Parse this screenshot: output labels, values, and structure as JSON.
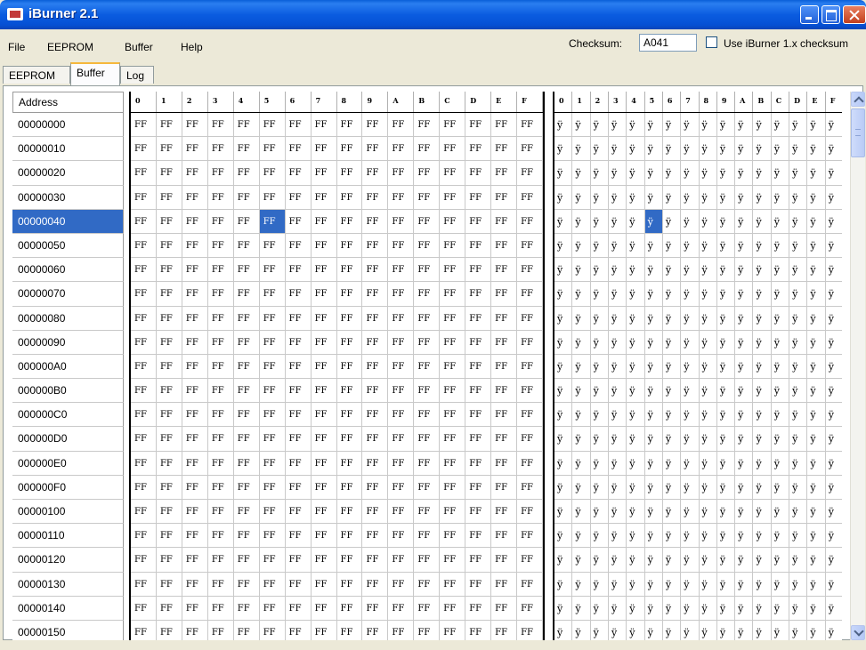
{
  "window": {
    "title": "iBurner 2.1"
  },
  "menu": {
    "items": [
      "File",
      "EEPROM",
      "Buffer",
      "Help"
    ]
  },
  "checksum": {
    "label": "Checksum:",
    "value": "A041",
    "use_legacy_label": "Use iBurner 1.x checksum",
    "use_legacy_checked": false
  },
  "tabs": [
    {
      "label": "EEPROM",
      "active": false
    },
    {
      "label": "Buffer",
      "active": true
    },
    {
      "label": "Log",
      "active": false
    }
  ],
  "grid": {
    "address_header": "Address",
    "hex_columns": [
      "0",
      "1",
      "2",
      "3",
      "4",
      "5",
      "6",
      "7",
      "8",
      "9",
      "A",
      "B",
      "C",
      "D",
      "E",
      "F"
    ],
    "ascii_columns": [
      "0",
      "1",
      "2",
      "3",
      "4",
      "5",
      "6",
      "7",
      "8",
      "9",
      "A",
      "B",
      "C",
      "D",
      "E",
      "F"
    ],
    "addresses": [
      "00000000",
      "00000010",
      "00000020",
      "00000030",
      "00000040",
      "00000050",
      "00000060",
      "00000070",
      "00000080",
      "00000090",
      "000000A0",
      "000000B0",
      "000000C0",
      "000000D0",
      "000000E0",
      "000000F0",
      "00000100",
      "00000110",
      "00000120",
      "00000130",
      "00000140",
      "00000150"
    ],
    "byte_value": "FF",
    "ascii_value": "ÿ",
    "selected_row": "00000040",
    "selected_column": "5"
  },
  "colors": {
    "selection": "#316ac5",
    "title_bar": "#0a5fd8",
    "active_tab_accent": "#f5b83d"
  }
}
